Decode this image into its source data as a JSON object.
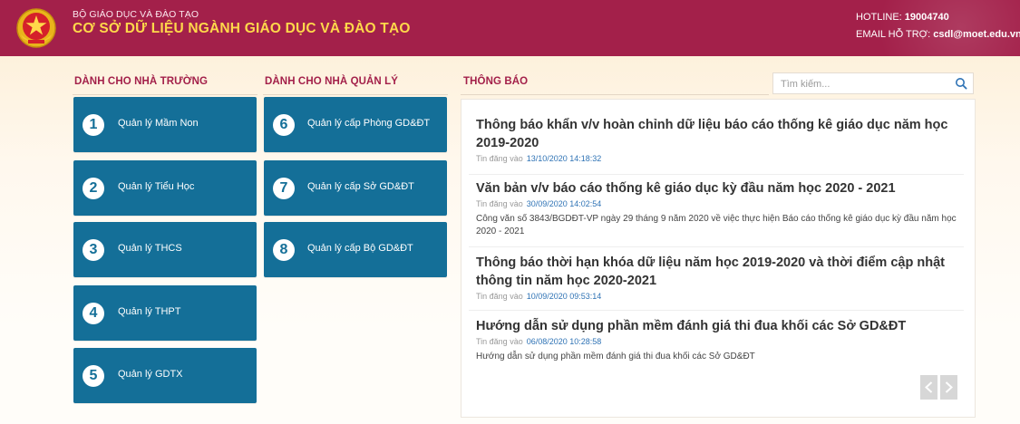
{
  "header": {
    "org_top": "BỘ GIÁO DỤC VÀ ĐÀO TẠO",
    "org_main": "CƠ SỞ DỮ LIỆU NGÀNH GIÁO DỤC VÀ ĐÀO TẠO",
    "hotline_label": "HOTLINE:",
    "hotline_value": "19004740",
    "email_label": "EMAIL HỖ TRỢ:",
    "email_value": "csdl@moet.edu.vn",
    "emblem_icon": "national-emblem-icon",
    "accent_color": "#a3204a",
    "title_color": "#ffd84a"
  },
  "schools": {
    "heading": "DÀNH CHO NHÀ TRƯỜNG",
    "items": [
      {
        "num": "1",
        "label": "Quản lý Mầm Non"
      },
      {
        "num": "2",
        "label": "Quản lý Tiểu Học"
      },
      {
        "num": "3",
        "label": "Quản lý THCS"
      },
      {
        "num": "4",
        "label": "Quản lý THPT"
      },
      {
        "num": "5",
        "label": "Quản lý GDTX"
      }
    ]
  },
  "managers": {
    "heading": "DÀNH CHO NHÀ QUẢN LÝ",
    "items": [
      {
        "num": "6",
        "label": "Quản lý cấp Phòng GD&ĐT"
      },
      {
        "num": "7",
        "label": "Quản lý cấp Sở GD&ĐT"
      },
      {
        "num": "8",
        "label": "Quản lý cấp Bộ GD&ĐT"
      }
    ]
  },
  "tile_color": "#146f98",
  "notices": {
    "heading": "THÔNG BÁO",
    "search_placeholder": "Tìm kiếm...",
    "search_icon": "search-icon",
    "posted_label": "Tin đăng vào",
    "items": [
      {
        "title": "Thông báo khẩn v/v hoàn chỉnh dữ liệu báo cáo thống kê giáo dục năm học 2019-2020",
        "date": "13/10/2020 14:18:32",
        "desc": ""
      },
      {
        "title": "Văn bản v/v báo cáo thống kê giáo dục kỳ đầu năm học 2020 - 2021",
        "date": "30/09/2020 14:02:54",
        "desc": "Công văn số 3843/BGDĐT-VP ngày 29 tháng 9 năm 2020 về việc thực hiện Báo cáo thống kê giáo dục kỳ đầu năm học 2020 - 2021"
      },
      {
        "title": "Thông báo thời hạn khóa dữ liệu năm học 2019-2020 và thời điểm cập nhật thông tin năm học 2020-2021",
        "date": "10/09/2020 09:53:14",
        "desc": ""
      },
      {
        "title": "Hướng dẫn sử dụng phần mềm đánh giá thi đua khối các Sở GD&ĐT",
        "date": "06/08/2020 10:28:58",
        "desc": "Hướng dẫn sử dụng phần mềm đánh giá thi đua khối các Sở GD&ĐT"
      }
    ],
    "prev_icon": "chevron-left-icon",
    "next_icon": "chevron-right-icon"
  }
}
